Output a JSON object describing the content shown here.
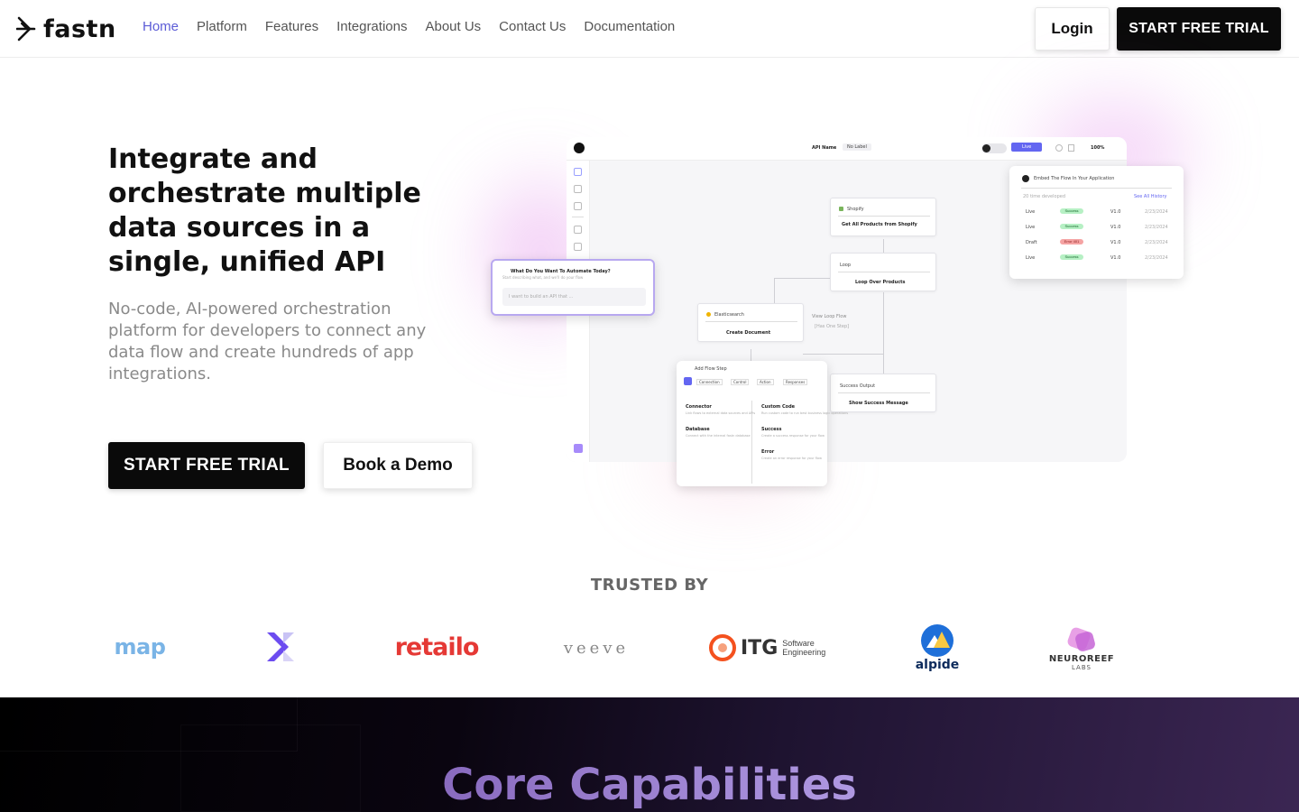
{
  "nav": {
    "brand": "fastn",
    "links": [
      "Home",
      "Platform",
      "Features",
      "Integrations",
      "About Us",
      "Contact Us",
      "Documentation"
    ],
    "login": "Login",
    "trial": "START FREE TRIAL"
  },
  "hero": {
    "title": "Integrate and orchestrate multiple data sources in a single, unified API",
    "subtitle": "No-code, AI-powered orchestration platform for developers to connect any data flow and create hundreds of app integrations.",
    "cta_primary": "START FREE TRIAL",
    "cta_secondary": "Book a Demo"
  },
  "mockup": {
    "api_name": "API Name",
    "label": "No Label",
    "live": "Live",
    "zoom": "100%",
    "prompt_title": "What Do You Want To Automate Today?",
    "prompt_sub": "Start describing what, and we'll do your flow",
    "prompt_placeholder": "I want to build an API that ...",
    "node_shopify_tag": "Shopify",
    "node_shopify": "Get All Products from Shopify",
    "node_loop_tag": "Loop",
    "node_loop": "Loop Over Products",
    "node_es_tag": "Elasticsearch",
    "node_es": "Create Document",
    "loop_flow": "View Loop Flow",
    "loop_steps": "[Has One Step]",
    "node_success_tag": "Success Output",
    "node_success": "Show Success Message",
    "add_step": "Add Flow Step",
    "step_tabs": [
      "Connection",
      "Control",
      "Action",
      "Responses"
    ],
    "connector": "Connector",
    "connector_desc": "Link flows to external data sources and APIs",
    "database": "Database",
    "database_desc": "Connect with the internal fastn database",
    "custom_code": "Custom Code",
    "custom_code_desc": "Run custom code to run best business logic operations",
    "success": "Success",
    "success_desc": "Create a success response for your flow",
    "error": "Error",
    "error_desc": "Create an error response for your flow",
    "embed_title": "Embed The Flow In Your Application",
    "embed_sub": "20 time developed",
    "see_all": "See All History",
    "history": [
      {
        "env": "Live",
        "status": "Success",
        "version": "V1.0",
        "date": "2/23/2024"
      },
      {
        "env": "Live",
        "status": "Success",
        "version": "V1.0",
        "date": "2/23/2024"
      },
      {
        "env": "Draft",
        "status": "Error 401",
        "version": "V1.0",
        "date": "2/23/2024"
      },
      {
        "env": "Live",
        "status": "Success",
        "version": "V1.0",
        "date": "2/23/2024"
      }
    ]
  },
  "trusted": {
    "heading": "TRUSTED BY",
    "logos": [
      "map",
      "retailo",
      "veeve",
      "ITG",
      "Software",
      "Engineering",
      "alpide",
      "NEUROREEF",
      "LABS"
    ]
  },
  "core": {
    "title": "Core Capabilities"
  },
  "colors": {
    "accent": "#5b5bd6",
    "dark": "#0a0a0a",
    "retailo": "#e53935",
    "itg_orange": "#f4511e",
    "alpide_blue": "#1e6fd9",
    "neuroreef_pink": "#d46bd8"
  }
}
